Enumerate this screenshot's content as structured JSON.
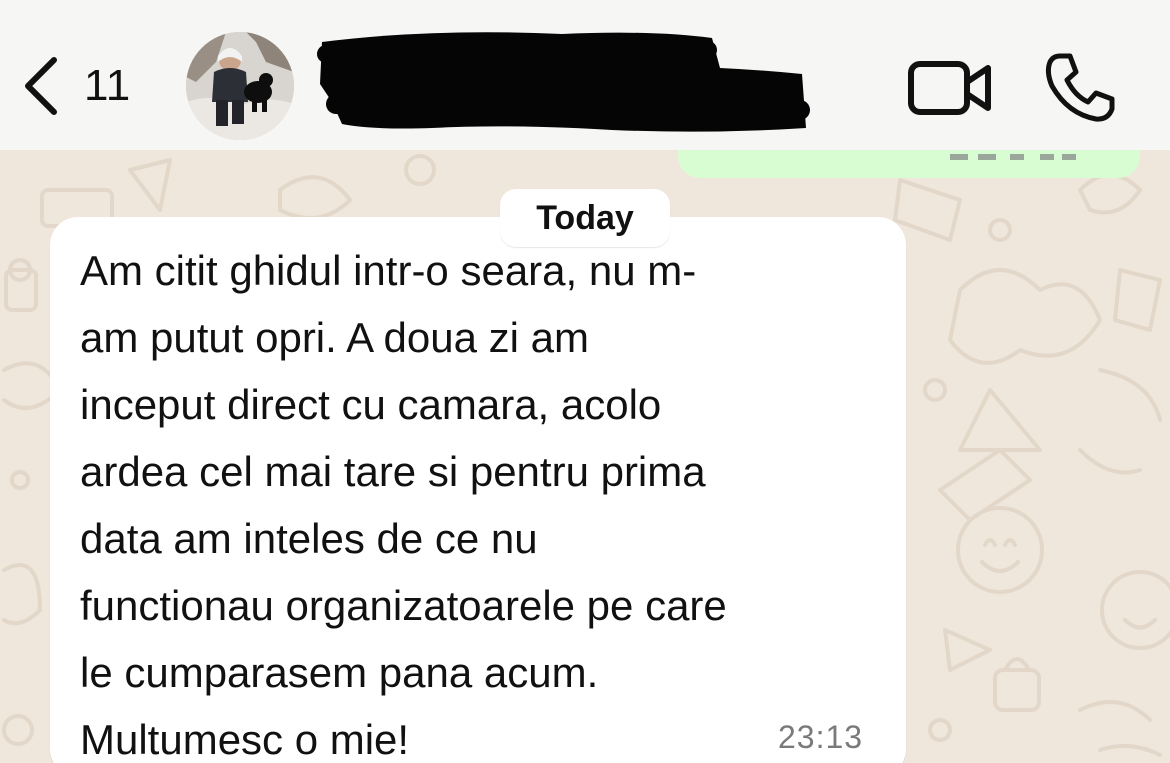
{
  "header": {
    "back_icon": "chevron-left-icon",
    "unread_count": "11",
    "avatar": "contact-avatar-photo",
    "contact_name_redacted": true,
    "video_icon": "video-camera-icon",
    "call_icon": "phone-icon",
    "colors": {
      "background": "#f6f6f5",
      "icon": "#111111"
    }
  },
  "chat": {
    "date_separator": "Today",
    "message": {
      "lines": [
        "Am citit ghidul intr-o seara, nu m-",
        "am putut opri. A doua zi am",
        "inceput direct cu camara, acolo",
        "ardea cel mai tare si pentru prima",
        "data am inteles de ce nu",
        "functionau organizatoarele pe care",
        "le cumparasem pana acum.",
        "Multumesc o mie!"
      ],
      "time": "23:13"
    },
    "colors": {
      "wallpaper": "#efe7dc",
      "incoming_bubble": "#ffffff",
      "outgoing_bubble": "#d9fdd3",
      "timestamp": "#7a7a7a"
    }
  }
}
